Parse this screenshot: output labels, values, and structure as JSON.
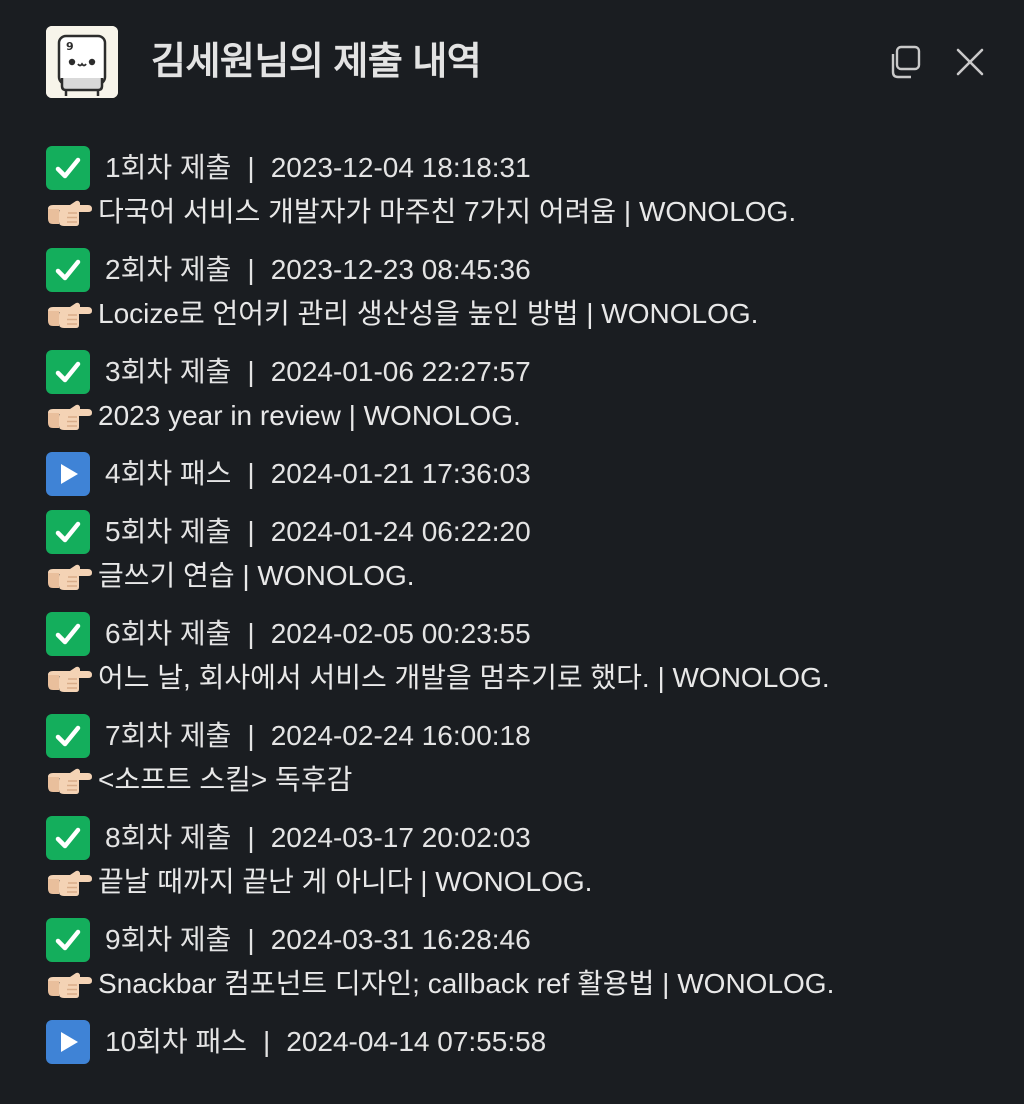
{
  "header": {
    "title": "김세원님의 제출 내역",
    "logo_badge": "9"
  },
  "colors": {
    "background": "#1a1d21",
    "check_green": "#14ae5c",
    "play_blue": "#3f83d6"
  },
  "entries": [
    {
      "status": "check",
      "label": "1회차 제출",
      "timestamp": "2023-12-04 18:18:31",
      "link": "다국어 서비스 개발자가 마주친 7가지 어려움 | WONOLOG."
    },
    {
      "status": "check",
      "label": "2회차 제출",
      "timestamp": "2023-12-23 08:45:36",
      "link": "Locize로 언어키 관리 생산성을 높인 방법 | WONOLOG."
    },
    {
      "status": "check",
      "label": "3회차 제출",
      "timestamp": "2024-01-06 22:27:57",
      "link": "2023 year in review | WONOLOG."
    },
    {
      "status": "play",
      "label": "4회차 패스",
      "timestamp": "2024-01-21 17:36:03",
      "link": null
    },
    {
      "status": "check",
      "label": "5회차 제출",
      "timestamp": "2024-01-24 06:22:20",
      "link": "글쓰기 연습 | WONOLOG."
    },
    {
      "status": "check",
      "label": "6회차 제출",
      "timestamp": "2024-02-05 00:23:55",
      "link": "어느 날, 회사에서 서비스 개발을 멈추기로 했다. | WONOLOG."
    },
    {
      "status": "check",
      "label": "7회차 제출",
      "timestamp": "2024-02-24 16:00:18",
      "link": "<소프트 스킬> 독후감"
    },
    {
      "status": "check",
      "label": "8회차 제출",
      "timestamp": "2024-03-17 20:02:03",
      "link": "끝날 때까지 끝난 게 아니다 | WONOLOG."
    },
    {
      "status": "check",
      "label": "9회차 제출",
      "timestamp": "2024-03-31 16:28:46",
      "link": "Snackbar 컴포넌트 디자인; callback ref 활용법 | WONOLOG."
    },
    {
      "status": "play",
      "label": "10회차 패스",
      "timestamp": "2024-04-14 07:55:58",
      "link": null
    }
  ],
  "separator": "|"
}
